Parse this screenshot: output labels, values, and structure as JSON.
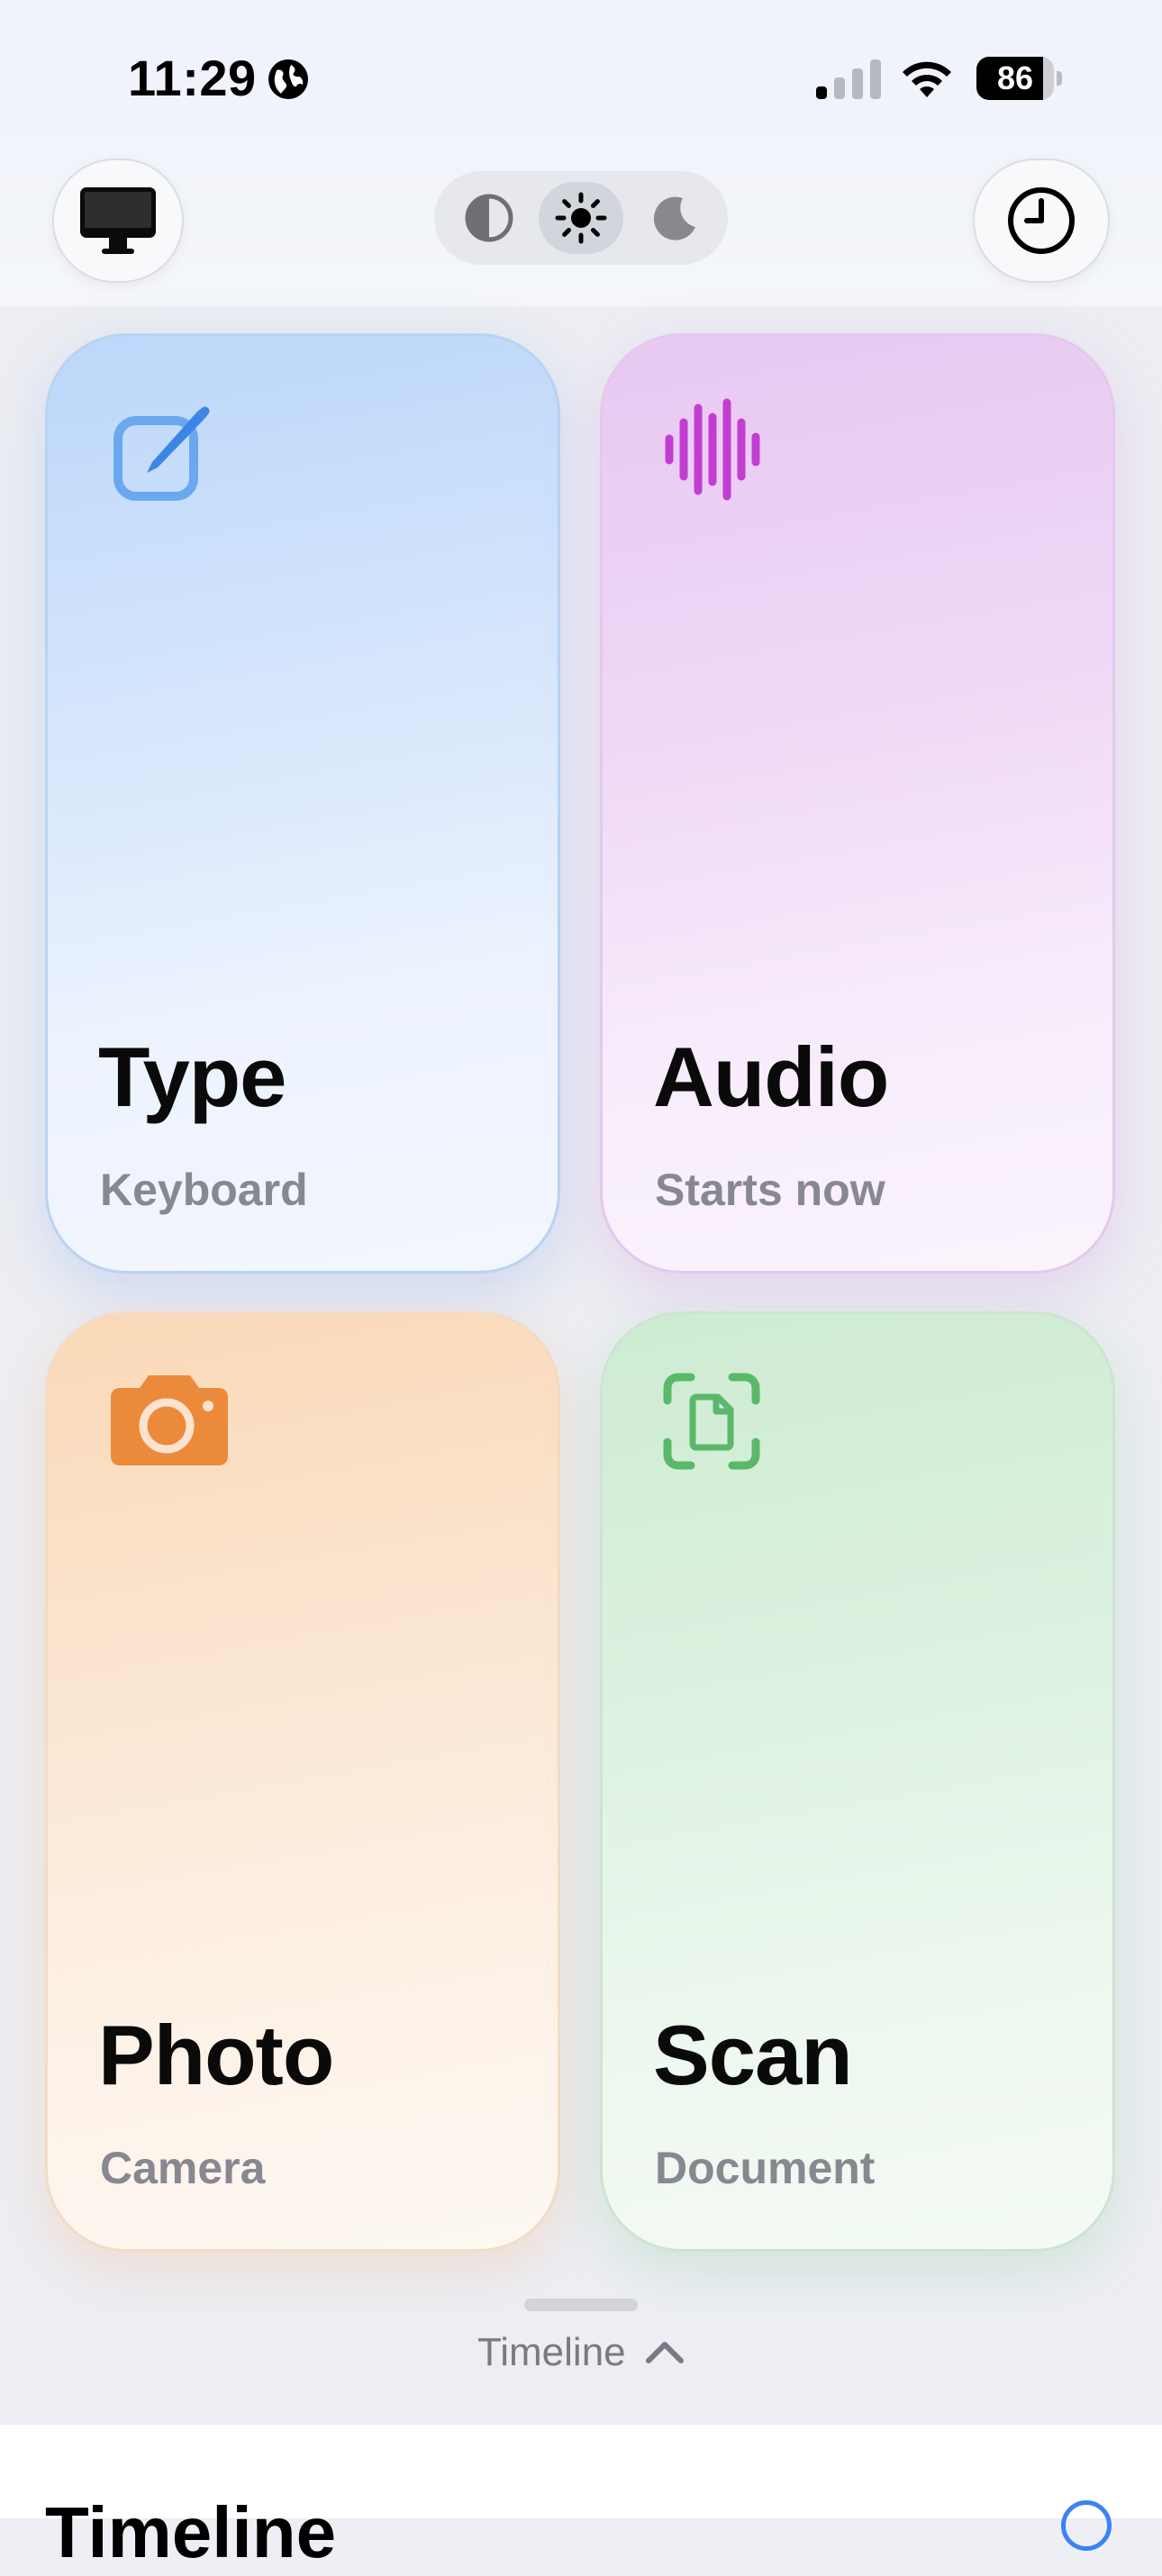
{
  "status_bar": {
    "time": "11:29",
    "battery_level": "86",
    "battery_fraction": 0.86,
    "signal_bars_active": 1,
    "signal_bars_total": 4,
    "icons": [
      "globe-icon",
      "cellular-signal-icon",
      "wifi-icon",
      "battery-icon"
    ]
  },
  "header": {
    "left_button_icon": "desktop-monitor-icon",
    "right_button_icon": "clock-history-icon",
    "theme_toggle": {
      "options": [
        "auto-contrast-icon",
        "sun-icon",
        "moon-icon"
      ],
      "selected": "sun-icon"
    }
  },
  "cards": [
    {
      "title": "Type",
      "subtitle": "Keyboard",
      "icon": "pencil-square-icon",
      "accent": "#4a8fe8"
    },
    {
      "title": "Audio",
      "subtitle": "Starts now",
      "icon": "audio-waveform-icon",
      "accent": "#c23ed1"
    },
    {
      "title": "Photo",
      "subtitle": "Camera",
      "icon": "camera-icon",
      "accent": "#ec8a3c"
    },
    {
      "title": "Scan",
      "subtitle": "Document",
      "icon": "document-scan-icon",
      "accent": "#5bb86a"
    }
  ],
  "drawer": {
    "toggle_label": "Timeline",
    "toggle_icon": "chevron-up-icon"
  },
  "timeline_sheet": {
    "title": "Timeline",
    "action_icon": "circle-action-icon",
    "action_color": "#3b82f6"
  }
}
